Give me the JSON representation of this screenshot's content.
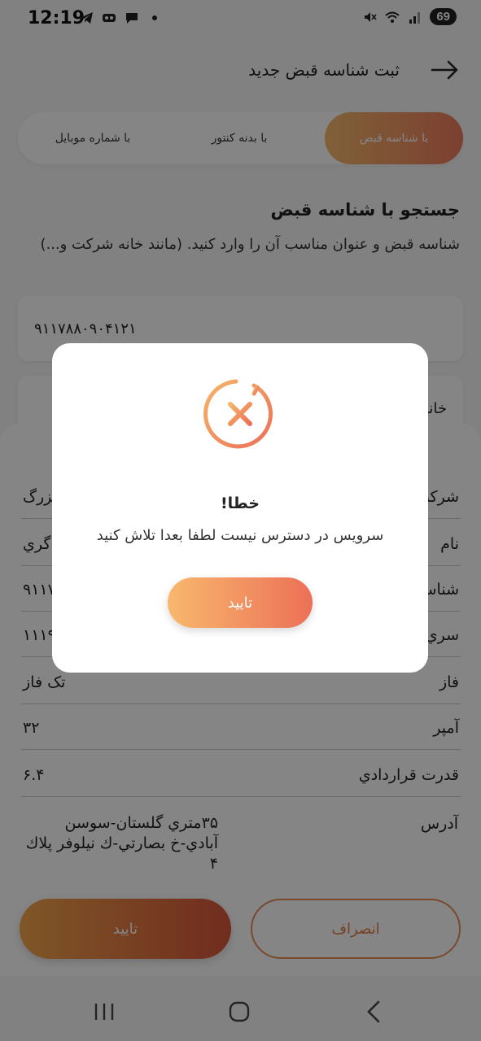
{
  "status_bar": {
    "time": "12:19",
    "battery": "69",
    "icons": [
      "telegram-icon",
      "voicemail-icon",
      "chat-icon",
      "dot-icon",
      "mute-icon",
      "wifi-icon",
      "signal-icon"
    ]
  },
  "header": {
    "title": "ثبت شناسه قبض جدید"
  },
  "tabs": [
    {
      "label": "با شناسه قبض"
    },
    {
      "label": "با بدنه کنتور"
    },
    {
      "label": "با شماره موبایل"
    }
  ],
  "search": {
    "title": "جستجو با شناسه قبض",
    "description": "شناسه قبض و عنوان مناسب آن را وارد کنید. (مانند خانه شرکت و...)",
    "bill_id_value": "۹۱۱۷۸۸۰۹۰۴۱۲۱",
    "title_field_label": "خانه"
  },
  "details": {
    "rows": [
      {
        "label": "شرکت",
        "value": "بزرگ"
      },
      {
        "label": "نام",
        "value": "گري"
      },
      {
        "label": "شناسه",
        "value": "۹۱۱۷"
      },
      {
        "label": "سري",
        "value": "۱۱۱۹۲"
      },
      {
        "label": "فاز",
        "value": "تک فاز"
      },
      {
        "label": "آمپر",
        "value": "۳۲"
      },
      {
        "label": "قدرت قراردادي",
        "value": "۶.۴"
      }
    ],
    "address_label": "آدرس",
    "address_value": "۳۵متري گلستان-سوسن آبادي-خ بصارتي-ك نيلوفر پلاك ۴"
  },
  "actions": {
    "confirm_label": "تایید",
    "cancel_label": "انصراف"
  },
  "dialog": {
    "title": "خطا!",
    "message": "سرویس در دسترس نیست لطفا بعدا تلاش کنید",
    "ok_label": "تایید"
  },
  "colors": {
    "accent_start": "#f8b86d",
    "accent_end": "#ec7057"
  }
}
